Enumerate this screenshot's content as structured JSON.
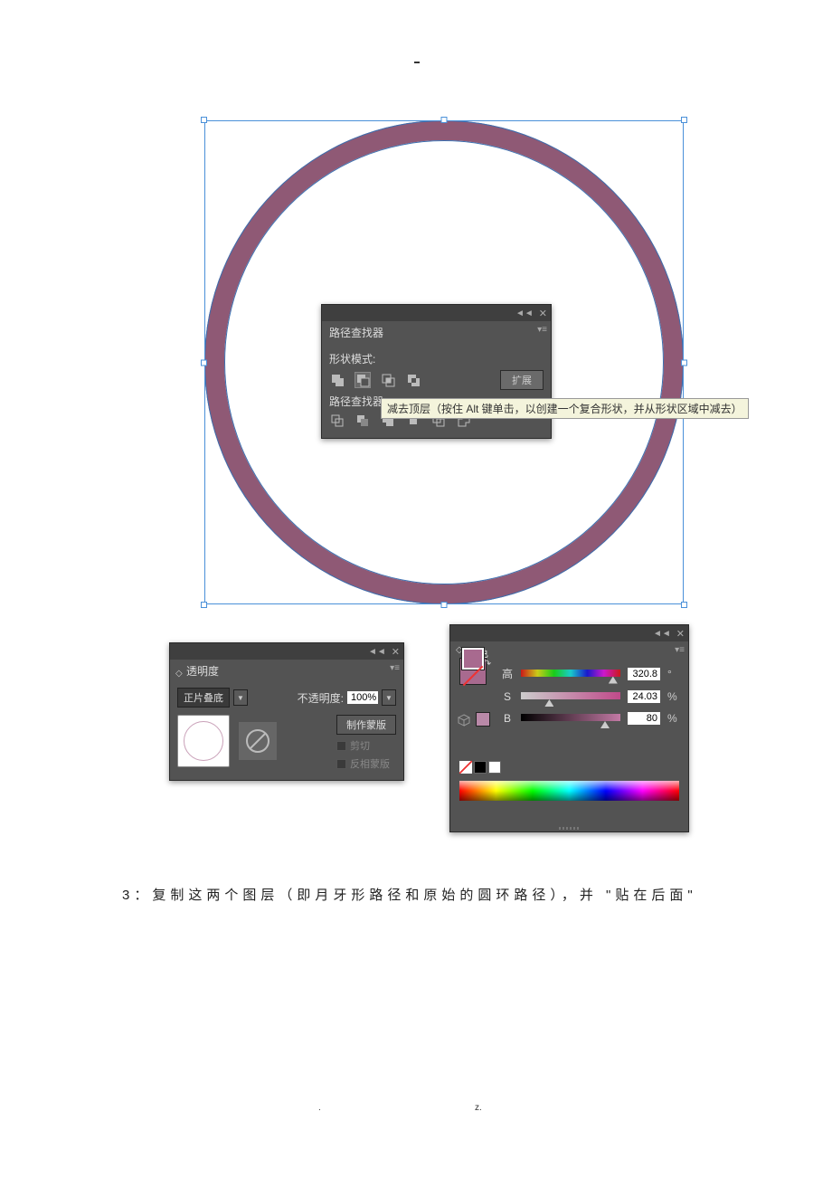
{
  "top_dash": "-",
  "pathfinder": {
    "tab": "路径查找器",
    "shape_mode_label": "形状模式:",
    "expand_btn": "扩展",
    "pathfinders_label": "路径查找器:",
    "tooltip": "减去顶层（按住 Alt 键单击，以创建一个复合形状，并从形状区域中减去）",
    "collapse": "◄◄",
    "close": "✕",
    "menu": "▾≡"
  },
  "transparency": {
    "tab": "透明度",
    "blend_mode": "正片叠底",
    "opacity_label": "不透明度:",
    "opacity_value": "100%",
    "make_mask": "制作蒙版",
    "clip": "剪切",
    "invert": "反相蒙版",
    "collapse": "◄◄",
    "close": "✕",
    "menu": "▾≡",
    "diamond": "◇"
  },
  "color": {
    "tab": "颜色",
    "h_label": "高",
    "s_label": "S",
    "b_label": "B",
    "h_value": "320.8",
    "h_unit": "°",
    "s_value": "24.03",
    "s_unit": "%",
    "b_value": "80",
    "b_unit": "%",
    "collapse": "◄◄",
    "close": "✕",
    "menu": "▾≡",
    "diamond": "◇",
    "swap": "↷"
  },
  "caption": "3：复制这两个图层（即月牙形路径和原始的圆环路径），并 \"贴在后面\"",
  "footer": {
    "a": ".",
    "b": "z."
  }
}
